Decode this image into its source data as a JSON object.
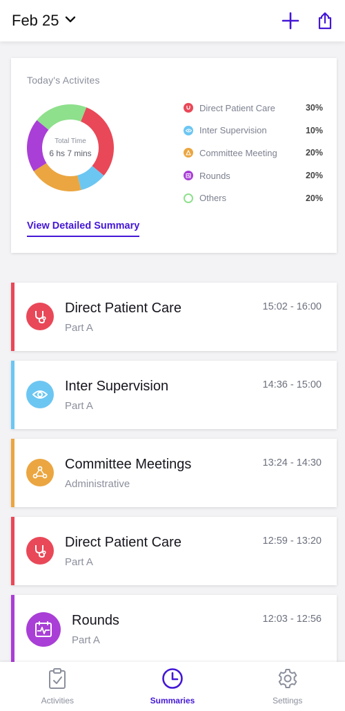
{
  "header": {
    "date_label": "Feb 25",
    "icons": [
      "chevron-down-icon",
      "plus-icon",
      "share-icon"
    ],
    "accent": "#4417d6"
  },
  "summary": {
    "title": "Today's Activites",
    "total_label": "Total Time",
    "total_value": "6 hs 7 mins",
    "link_label": "View Detailed Summary",
    "legend": [
      {
        "name": "Direct Patient Care",
        "pct": "30%",
        "color": "#e94858",
        "icon": "stethoscope-icon"
      },
      {
        "name": "Inter Supervision",
        "pct": "10%",
        "color": "#6cc6f2",
        "icon": "eye-icon"
      },
      {
        "name": "Committee  Meeting",
        "pct": "20%",
        "color": "#eba641",
        "icon": "meeting-icon"
      },
      {
        "name": "Rounds",
        "pct": "20%",
        "color": "#a93fd6",
        "icon": "rounds-icon"
      },
      {
        "name": "Others",
        "pct": "20%",
        "color": "#8ee08c",
        "icon": "circle-icon"
      }
    ]
  },
  "chart_data": {
    "type": "pie",
    "categories": [
      "Direct Patient Care",
      "Inter Supervision",
      "Committee  Meeting",
      "Rounds",
      "Others"
    ],
    "values": [
      30,
      10,
      20,
      20,
      20
    ],
    "colors": [
      "#e94858",
      "#6cc6f2",
      "#eba641",
      "#a93fd6",
      "#8ee08c"
    ],
    "title": "Today's Activites"
  },
  "activities": [
    {
      "title": "Direct Patient Care",
      "subtitle": "Part A",
      "time": "15:02 - 16:00",
      "color": "#e94858",
      "icon": "stethoscope-icon"
    },
    {
      "title": "Inter Supervision",
      "subtitle": "Part A",
      "time": "14:36 - 15:00",
      "color": "#6cc6f2",
      "icon": "eye-icon"
    },
    {
      "title": "Committee Meetings",
      "subtitle": "Administrative",
      "time": "13:24 - 14:30",
      "color": "#eba641",
      "icon": "meeting-icon"
    },
    {
      "title": "Direct Patient Care",
      "subtitle": "Part A",
      "time": "12:59 - 13:20",
      "color": "#e94858",
      "icon": "stethoscope-icon"
    },
    {
      "title": "Rounds",
      "subtitle": "Part A",
      "time": "12:03 - 12:56",
      "color": "#a93fd6",
      "icon": "rounds-icon"
    }
  ],
  "tabbar": {
    "tabs": [
      {
        "label": "Activities",
        "icon": "clipboard-check-icon",
        "active": false
      },
      {
        "label": "Summaries",
        "icon": "clock-icon",
        "active": true
      },
      {
        "label": "Settings",
        "icon": "gear-icon",
        "active": false
      }
    ]
  }
}
